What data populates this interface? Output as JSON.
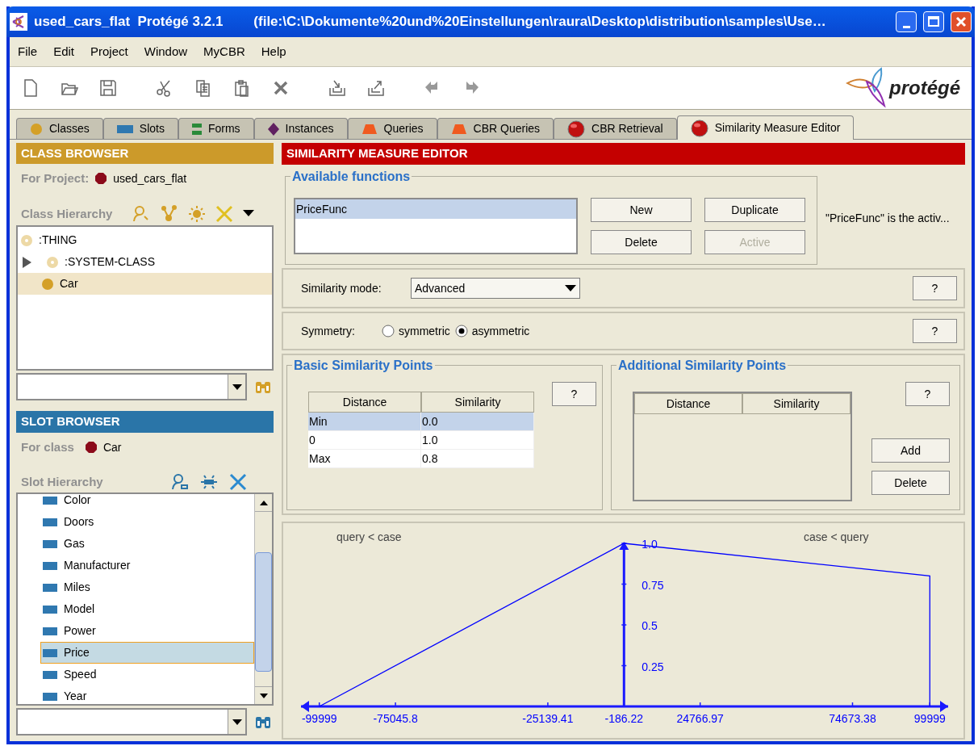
{
  "window": {
    "title": "used_cars_flat  Protégé 3.2.1",
    "file_path": "(file:\\C:\\Dokumente%20und%20Einstellungen\\raura\\Desktop\\distribution\\samples\\Use…"
  },
  "menu": [
    "File",
    "Edit",
    "Project",
    "Window",
    "MyCBR",
    "Help"
  ],
  "logo_text": "protégé",
  "tabs": [
    {
      "label": "Classes",
      "kind": "circle",
      "selected": false
    },
    {
      "label": "Slots",
      "kind": "rect",
      "selected": false
    },
    {
      "label": "Forms",
      "kind": "bars",
      "selected": false
    },
    {
      "label": "Instances",
      "kind": "diamond",
      "selected": false
    },
    {
      "label": "Queries",
      "kind": "trapezoid",
      "selected": false
    },
    {
      "label": "CBR Queries",
      "kind": "trapezoid",
      "selected": false
    },
    {
      "label": "CBR Retrieval",
      "kind": "ball",
      "selected": false
    },
    {
      "label": "Similarity Measure Editor",
      "kind": "ball",
      "selected": true
    }
  ],
  "class_browser": {
    "title": "CLASS BROWSER",
    "project_label": "For Project:",
    "project": "used_cars_flat",
    "hierarchy_label": "Class Hierarchy",
    "tree": [
      {
        "label": ":THING",
        "kind": "abstract",
        "selected": false
      },
      {
        "label": ":SYSTEM-CLASS",
        "kind": "abstract",
        "selected": false,
        "expanded": false
      },
      {
        "label": "Car",
        "kind": "concrete",
        "selected": true
      }
    ]
  },
  "slot_browser": {
    "title": "SLOT BROWSER",
    "class_label": "For class",
    "class": "Car",
    "hierarchy_label": "Slot Hierarchy",
    "slots": [
      {
        "label": "Color",
        "selected": false
      },
      {
        "label": "Doors",
        "selected": false
      },
      {
        "label": "Gas",
        "selected": false
      },
      {
        "label": "Manufacturer",
        "selected": false
      },
      {
        "label": "Miles",
        "selected": false
      },
      {
        "label": "Model",
        "selected": false
      },
      {
        "label": "Power",
        "selected": false
      },
      {
        "label": "Price",
        "selected": true
      },
      {
        "label": "Speed",
        "selected": false
      },
      {
        "label": "Year",
        "selected": false
      }
    ]
  },
  "editor": {
    "title": "SIMILARITY MEASURE EDITOR",
    "functions_legend": "Available functions",
    "functions": [
      {
        "label": "PriceFunc",
        "selected": true
      }
    ],
    "buttons": [
      {
        "label": "New",
        "disabled": false
      },
      {
        "label": "Duplicate",
        "disabled": false
      },
      {
        "label": "Delete",
        "disabled": false
      },
      {
        "label": "Active",
        "disabled": true
      }
    ],
    "status": "\"PriceFunc\" is the activ...",
    "mode": {
      "label": "Similarity mode:",
      "value": "Advanced",
      "help": "?"
    },
    "symmetry": {
      "label": "Symmetry:",
      "options": [
        {
          "label": "symmetric",
          "selected": false
        },
        {
          "label": "asymmetric",
          "selected": true
        }
      ],
      "help": "?"
    },
    "basic_points": {
      "legend": "Basic Similarity Points",
      "help": "?",
      "columns": [
        "Distance",
        "Similarity"
      ],
      "rows": [
        {
          "cells": [
            "Min",
            "0.0"
          ],
          "selected": true
        },
        {
          "cells": [
            "0",
            "1.0"
          ],
          "selected": false
        },
        {
          "cells": [
            "Max",
            "0.8"
          ],
          "selected": false
        }
      ]
    },
    "additional_points": {
      "legend": "Additional Similarity Points",
      "help": "?",
      "columns": [
        "Distance",
        "Similarity"
      ],
      "buttons": [
        "Add",
        "Delete"
      ]
    },
    "chart": {
      "left_label": "query < case",
      "right_label": "case < query",
      "chart_data": {
        "type": "line",
        "x": [
          -99999,
          -186.22,
          99999,
          99999
        ],
        "values": [
          0,
          1,
          0.8,
          0
        ],
        "xlim": [
          -106000,
          106000
        ],
        "ylim": [
          0,
          1
        ],
        "xticks": [
          -99999,
          -75045.8,
          -25139.41,
          -186.22,
          24766.97,
          74673.38,
          99999
        ],
        "yticks": [
          0.25,
          0.5,
          0.75,
          {
            "value": 1,
            "label": "1.0"
          }
        ]
      }
    }
  }
}
